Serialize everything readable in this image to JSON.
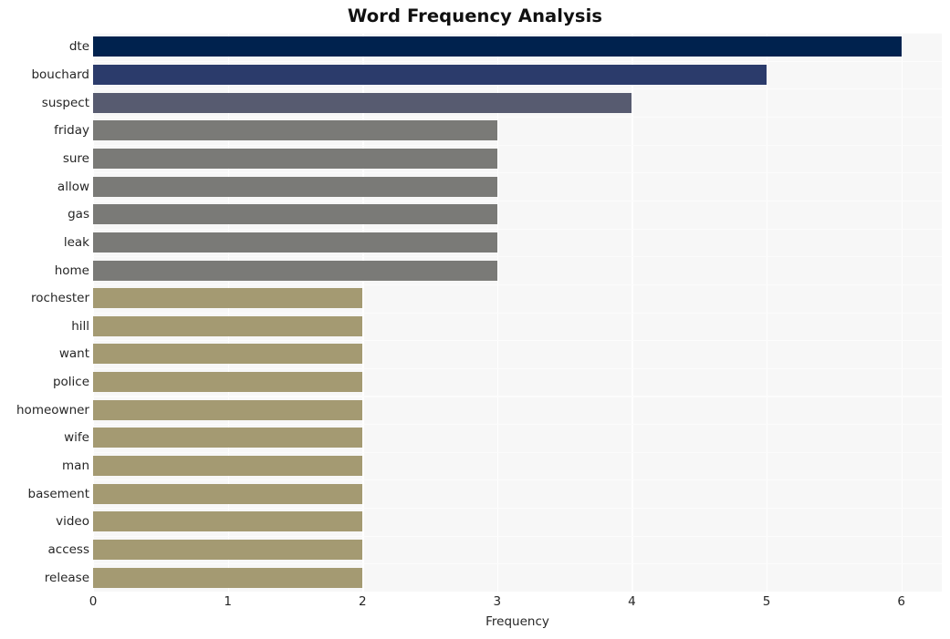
{
  "chart_data": {
    "type": "bar",
    "orientation": "horizontal",
    "title": "Word Frequency Analysis",
    "xlabel": "Frequency",
    "ylabel": "",
    "categories": [
      "dte",
      "bouchard",
      "suspect",
      "friday",
      "sure",
      "allow",
      "gas",
      "leak",
      "home",
      "rochester",
      "hill",
      "want",
      "police",
      "homeowner",
      "wife",
      "man",
      "basement",
      "video",
      "access",
      "release"
    ],
    "values": [
      6,
      5,
      4,
      3,
      3,
      3,
      3,
      3,
      3,
      2,
      2,
      2,
      2,
      2,
      2,
      2,
      2,
      2,
      2,
      2
    ],
    "bar_colors": [
      "#00224e",
      "#2b3b6b",
      "#575b70",
      "#7a7a77",
      "#7a7a77",
      "#7a7a77",
      "#7a7a77",
      "#7a7a77",
      "#7a7a77",
      "#a49a72",
      "#a49a72",
      "#a49a72",
      "#a49a72",
      "#a49a72",
      "#a49a72",
      "#a49a72",
      "#a49a72",
      "#a49a72",
      "#a49a72",
      "#a49a72"
    ],
    "xticks": [
      0,
      1,
      2,
      3,
      4,
      5,
      6
    ],
    "xtick_labels": [
      "0",
      "1",
      "2",
      "3",
      "4",
      "5",
      "6"
    ],
    "xlim": [
      0,
      6.3
    ],
    "grid": true,
    "grid_color": "#ffffff",
    "plot_background": "#f7f7f7",
    "figure_background": "#ffffff",
    "legend": null,
    "colormap": "cividis"
  }
}
